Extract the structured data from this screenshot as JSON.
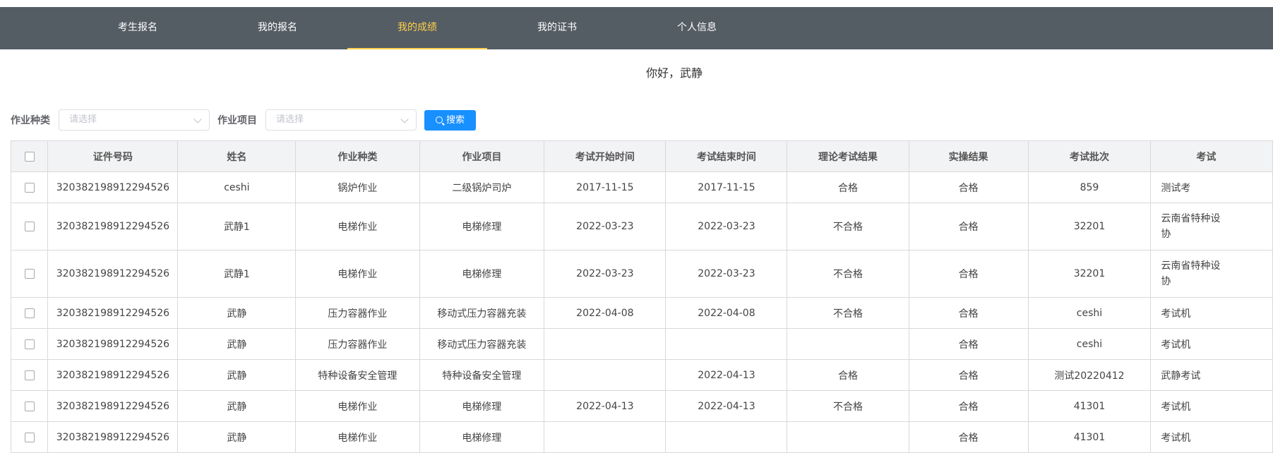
{
  "nav": {
    "items": [
      {
        "label": "考生报名"
      },
      {
        "label": "我的报名"
      },
      {
        "label": "我的成绩"
      },
      {
        "label": "我的证书"
      },
      {
        "label": "个人信息"
      }
    ]
  },
  "greeting": "你好，武静",
  "filters": {
    "category_label": "作业种类",
    "category_placeholder": "请选择",
    "project_label": "作业项目",
    "project_placeholder": "请选择",
    "search_label": "搜索"
  },
  "table": {
    "headers": [
      "证件号码",
      "姓名",
      "作业种类",
      "作业项目",
      "考试开始时间",
      "考试结束时间",
      "理论考试结果",
      "实操结果",
      "考试批次",
      "考试"
    ],
    "rows": [
      [
        "320382198912294526",
        "ceshi",
        "锅炉作业",
        "二级锅炉司炉",
        "2017-11-15",
        "2017-11-15",
        "合格",
        "合格",
        "859",
        "测试考"
      ],
      [
        "320382198912294526",
        "武静1",
        "电梯作业",
        "电梯修理",
        "2022-03-23",
        "2022-03-23",
        "不合格",
        "合格",
        "32201",
        "云南省特种设\n协"
      ],
      [
        "320382198912294526",
        "武静1",
        "电梯作业",
        "电梯修理",
        "2022-03-23",
        "2022-03-23",
        "不合格",
        "合格",
        "32201",
        "云南省特种设\n协"
      ],
      [
        "320382198912294526",
        "武静",
        "压力容器作业",
        "移动式压力容器充装",
        "2022-04-08",
        "2022-04-08",
        "不合格",
        "合格",
        "ceshi",
        "考试机"
      ],
      [
        "320382198912294526",
        "武静",
        "压力容器作业",
        "移动式压力容器充装",
        "",
        "",
        "",
        "合格",
        "ceshi",
        "考试机"
      ],
      [
        "320382198912294526",
        "武静",
        "特种设备安全管理",
        "特种设备安全管理",
        "",
        "2022-04-13",
        "合格",
        "合格",
        "测试20220412",
        "武静考试"
      ],
      [
        "320382198912294526",
        "武静",
        "电梯作业",
        "电梯修理",
        "2022-04-13",
        "2022-04-13",
        "不合格",
        "合格",
        "41301",
        "考试机"
      ],
      [
        "320382198912294526",
        "武静",
        "电梯作业",
        "电梯修理",
        "",
        "",
        "",
        "合格",
        "41301",
        "考试机"
      ]
    ]
  }
}
